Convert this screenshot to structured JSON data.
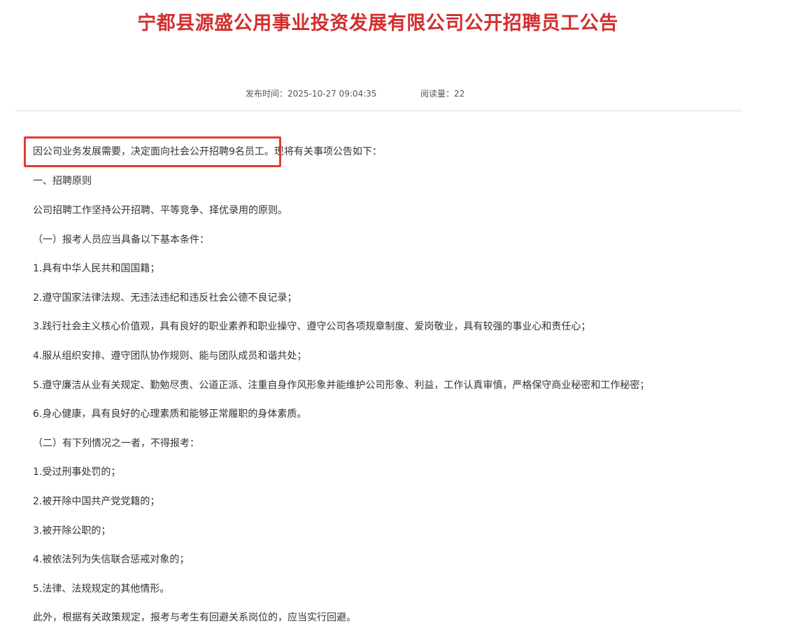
{
  "theme": {
    "title_color": "#d32f2f",
    "highlight_color": "#e53935",
    "divider_color": "#dddddd",
    "text_color": "#333333"
  },
  "header": {
    "title": "宁都县源盛公用事业投资发展有限公司公开招聘员工公告"
  },
  "meta": {
    "publish_time": "发布时间：2025-10-27 09:04:35",
    "view_count": "阅读量：22"
  },
  "article": {
    "paragraphs": [
      "因公司业务发展需要，决定面向社会公开招聘9名员工。现将有关事项公告如下：",
      "一、招聘原则",
      "公司招聘工作坚持公开招聘、平等竞争、择优录用的原则。",
      "（一）报考人员应当具备以下基本条件：",
      "1.具有中华人民共和国国籍；",
      "2.遵守国家法律法规、无违法违纪和违反社会公德不良记录；",
      "3.践行社会主义核心价值观，具有良好的职业素养和职业操守、遵守公司各项规章制度、爱岗敬业，具有较强的事业心和责任心；",
      "4.服从组织安排、遵守团队协作规则、能与团队成员和谐共处；",
      "5.遵守廉洁从业有关规定、勤勉尽责、公道正派、注重自身作风形象并能维护公司形象、利益，工作认真审慎，严格保守商业秘密和工作秘密；",
      "6.身心健康，具有良好的心理素质和能够正常履职的身体素质。",
      "（二）有下列情况之一者，不得报考：",
      "1.受过刑事处罚的；",
      "2.被开除中国共产党党籍的；",
      "3.被开除公职的；",
      "4.被依法列为失信联合惩戒对象的；",
      "5.法律、法规规定的其他情形。",
      "此外，根据有关政策规定，报考与考生有回避关系岗位的，应当实行回避。"
    ]
  }
}
